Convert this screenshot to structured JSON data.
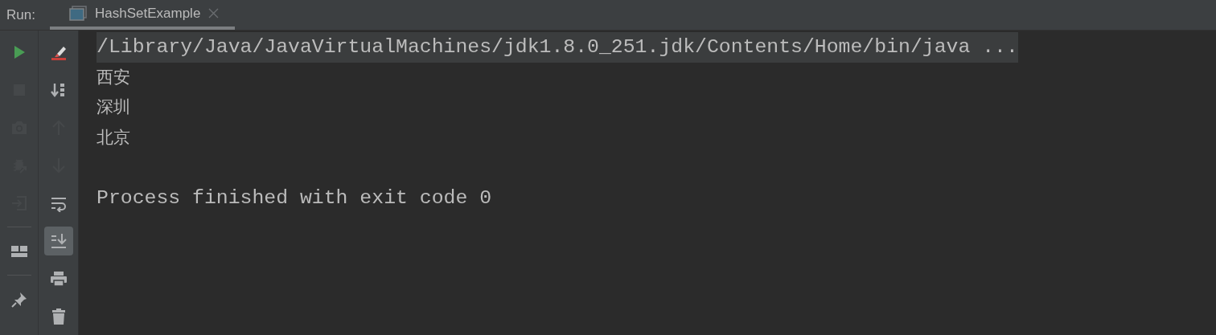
{
  "run_bar": {
    "label": "Run:",
    "tabs": [
      {
        "title": "HashSetExample",
        "selected": true
      }
    ]
  },
  "left_toolbar": [
    {
      "kind": "run",
      "disabled": false
    },
    {
      "kind": "stop",
      "disabled": true
    },
    {
      "kind": "camera",
      "disabled": true
    },
    {
      "kind": "bug",
      "disabled": true
    },
    {
      "kind": "enter",
      "disabled": true
    },
    {
      "kind": "separator"
    },
    {
      "kind": "layout",
      "disabled": false
    },
    {
      "kind": "separator"
    },
    {
      "kind": "pin",
      "disabled": false
    }
  ],
  "right_toolbar": [
    {
      "kind": "clear",
      "disabled": false,
      "selected": false
    },
    {
      "kind": "sort",
      "disabled": false,
      "selected": false
    },
    {
      "kind": "up",
      "disabled": true,
      "selected": false
    },
    {
      "kind": "down",
      "disabled": true,
      "selected": false
    },
    {
      "kind": "wrap",
      "disabled": false,
      "selected": false
    },
    {
      "kind": "scroll-end",
      "disabled": false,
      "selected": true
    },
    {
      "kind": "print",
      "disabled": false,
      "selected": false
    },
    {
      "kind": "trash",
      "disabled": false,
      "selected": false
    }
  ],
  "console": [
    {
      "kind": "command",
      "text": "/Library/Java/JavaVirtualMachines/jdk1.8.0_251.jdk/Contents/Home/bin/java ..."
    },
    {
      "kind": "output",
      "text": "西安"
    },
    {
      "kind": "output",
      "text": "深圳"
    },
    {
      "kind": "output",
      "text": "北京"
    },
    {
      "kind": "status",
      "text": "Process finished with exit code 0"
    }
  ]
}
